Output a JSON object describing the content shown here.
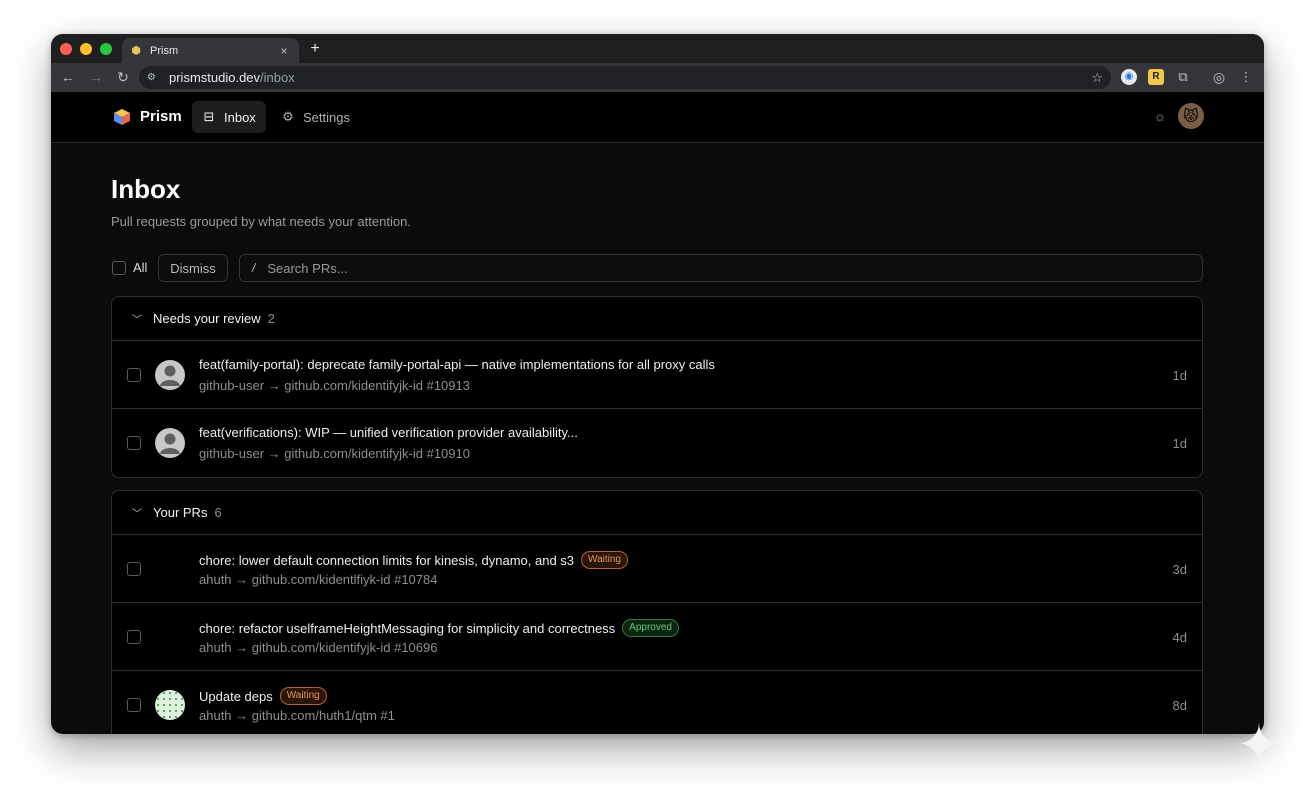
{
  "browser": {
    "tab_title": "Prism",
    "tab_close": "×",
    "new_tab": "+",
    "url_host": "prismstudio.dev",
    "url_path": "/inbox",
    "ext_badge": "R"
  },
  "nav": {
    "brand": "Prism",
    "items": [
      {
        "label": "Inbox",
        "icon": "inbox-icon",
        "active": true
      },
      {
        "label": "Settings",
        "icon": "gear-icon",
        "active": false
      }
    ]
  },
  "page": {
    "title": "Inbox",
    "subtitle": "Pull requests grouped by what needs your attention."
  },
  "filters": {
    "all_label": "All",
    "dismiss_label": "Dismiss",
    "search_slash": "/",
    "search_placeholder": "Search PRs..."
  },
  "groups": [
    {
      "title": "Needs your review",
      "count": "2",
      "rows": [
        {
          "title": "feat(family-portal): deprecate family-portal-api — native implementations for all proxy calls",
          "meta": "github-user → github.com/kidentifyjk-id #10913",
          "time": "1d",
          "avatar": "gray",
          "badge": ""
        },
        {
          "title": "feat(verifications): WIP — unified verification provider availability...",
          "meta": "github-user → github.com/kidentifyjk-id #10910",
          "time": "1d",
          "avatar": "gray",
          "badge": ""
        }
      ]
    },
    {
      "title": "Your PRs",
      "count": "6",
      "rows": [
        {
          "title": "chore: lower default connection limits for kinesis, dynamo, and s3",
          "meta": "ahuth → github.com/kidentlfiyk-id #10784",
          "time": "3d",
          "avatar": "cat",
          "badge": "Waiting"
        },
        {
          "title": "chore: refactor uselframeHeightMessaging for simplicity and correctness",
          "meta": "ahuth → github.com/kidentifyjk-id #10696",
          "time": "4d",
          "avatar": "cat",
          "badge": "Approved"
        },
        {
          "title": "Update deps",
          "meta": "ahuth → github.com/huth1/qtm #1",
          "time": "8d",
          "avatar": "pattern",
          "badge": "Waiting"
        }
      ]
    }
  ],
  "colors": {
    "waiting": "#e8935a",
    "approved": "#62c977",
    "background": "#0b0b0b"
  }
}
